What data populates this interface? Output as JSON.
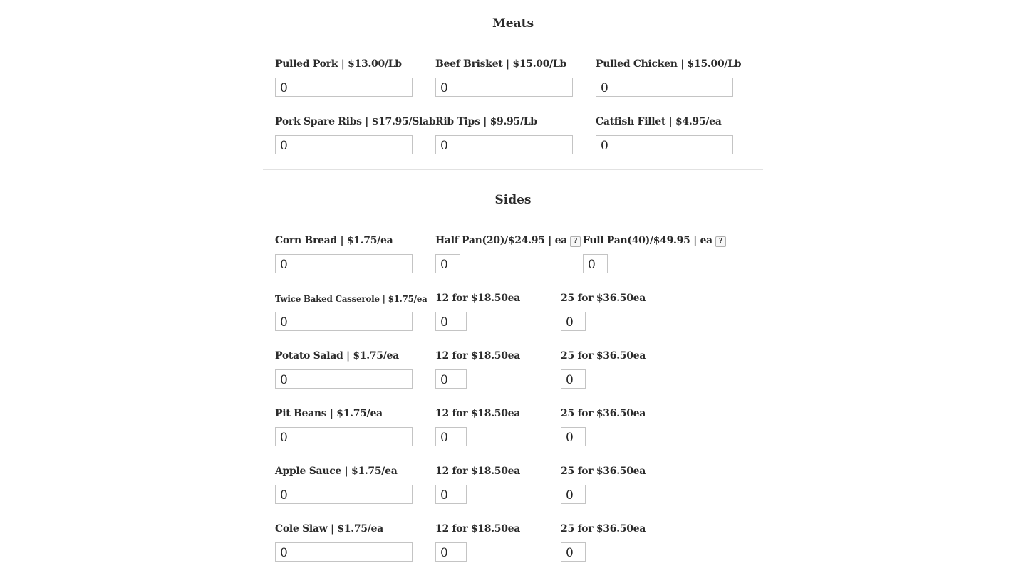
{
  "meats": {
    "title": "Meats",
    "items": [
      {
        "label": "Pulled Pork | $13.00/Lb",
        "value": "0"
      },
      {
        "label": "Beef Brisket | $15.00/Lb",
        "value": "0"
      },
      {
        "label": "Pulled Chicken | $15.00/Lb",
        "value": "0"
      },
      {
        "label": "Pork Spare Ribs | $17.95/Slab",
        "value": "0"
      },
      {
        "label": "Rib Tips | $9.95/Lb",
        "value": "0"
      },
      {
        "label": "Catfish Fillet | $4.95/ea",
        "value": "0"
      }
    ]
  },
  "sides": {
    "title": "Sides",
    "corn_bread": {
      "label": "Corn Bread | $1.75/ea",
      "value": "0",
      "half_pan_label": "Half Pan(20)/$24.95 | ea",
      "half_pan_value": "0",
      "full_pan_label": "Full Pan(40)/$49.95 | ea",
      "full_pan_value": "0",
      "help_glyph": "?"
    },
    "rows": [
      {
        "label": "Twice Baked Casserole | $1.75/ea",
        "value": "0",
        "dozen_label": "12 for $18.50ea",
        "dozen_value": "0",
        "bulk_label": "25 for $36.50ea",
        "bulk_value": "0"
      },
      {
        "label": "Potato Salad | $1.75/ea",
        "value": "0",
        "dozen_label": "12 for $18.50ea",
        "dozen_value": "0",
        "bulk_label": "25 for $36.50ea",
        "bulk_value": "0"
      },
      {
        "label": "Pit Beans | $1.75/ea",
        "value": "0",
        "dozen_label": "12 for $18.50ea",
        "dozen_value": "0",
        "bulk_label": "25 for $36.50ea",
        "bulk_value": "0"
      },
      {
        "label": "Apple Sauce | $1.75/ea",
        "value": "0",
        "dozen_label": "12 for $18.50ea",
        "dozen_value": "0",
        "bulk_label": "25 for $36.50ea",
        "bulk_value": "0"
      },
      {
        "label": "Cole Slaw | $1.75/ea",
        "value": "0",
        "dozen_label": "12 for $18.50ea",
        "dozen_value": "0",
        "bulk_label": "25 for $36.50ea",
        "bulk_value": "0"
      }
    ]
  }
}
